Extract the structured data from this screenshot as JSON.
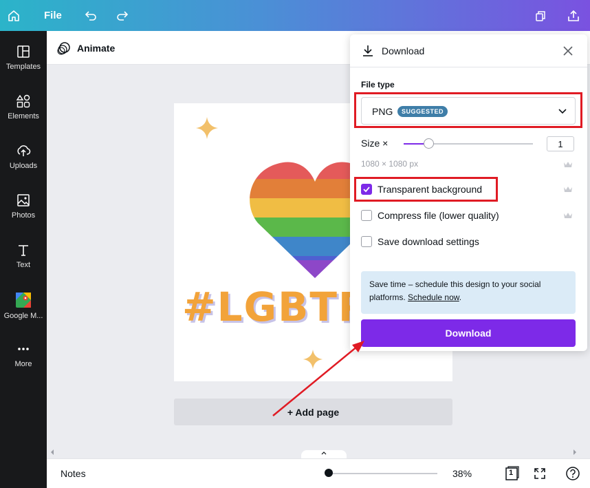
{
  "topbar": {
    "file_label": "File"
  },
  "sidebar": {
    "items": [
      {
        "label": "Templates",
        "icon": "templates-icon"
      },
      {
        "label": "Elements",
        "icon": "elements-icon"
      },
      {
        "label": "Uploads",
        "icon": "uploads-icon"
      },
      {
        "label": "Photos",
        "icon": "photos-icon"
      },
      {
        "label": "Text",
        "icon": "text-icon"
      },
      {
        "label": "Google M...",
        "icon": "google-maps-icon"
      },
      {
        "label": "More",
        "icon": "more-icon"
      }
    ]
  },
  "toolbar": {
    "animate_label": "Animate"
  },
  "canvas": {
    "design_text": "#LGBTP",
    "add_page_label": "+ Add page",
    "heart_colors": [
      "#e45a5a",
      "#e27f39",
      "#f0bd44",
      "#5bb84a",
      "#3f86c9",
      "#4f5fd1",
      "#8d47c8"
    ],
    "sparkle_color": "#f2c06a"
  },
  "bottombar": {
    "notes_label": "Notes",
    "zoom_value": "38%",
    "page_count": "1"
  },
  "download_panel": {
    "title": "Download",
    "file_type_label": "File type",
    "file_type_value": "PNG",
    "suggested_badge": "SUGGESTED",
    "size_label": "Size ×",
    "size_value": "1",
    "dimensions": "1080 × 1080 px",
    "transparent_label": "Transparent background",
    "transparent_checked": true,
    "compress_label": "Compress file (lower quality)",
    "save_settings_label": "Save download settings",
    "info_text": "Save time – schedule this design to your social platforms.",
    "info_link": "Schedule now",
    "info_suffix": ".",
    "download_button": "Download"
  },
  "colors": {
    "accent": "#7d2ae8",
    "highlight": "#e01b24",
    "info_bg": "#dbebf7"
  }
}
